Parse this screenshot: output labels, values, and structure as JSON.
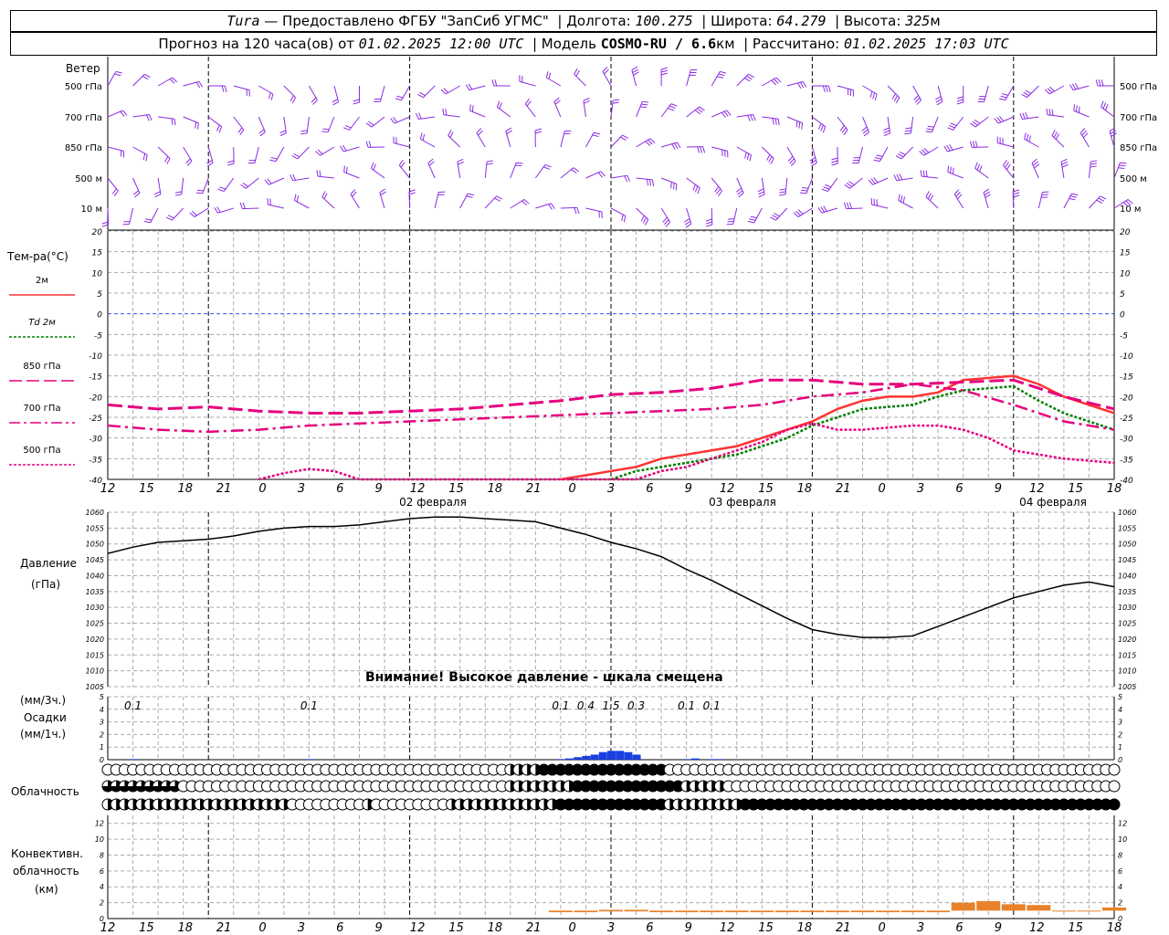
{
  "header": {
    "station": "Tura",
    "provider": "— Предоставлено ФГБУ \"ЗапСиб УГМС\"",
    "lon_label": "Долгота:",
    "lon_value": "100.275",
    "lat_label": "Широта:",
    "lat_value": "64.279",
    "alt_label": "Высота:",
    "alt_value": "325",
    "alt_unit": "м",
    "forecast_label": "Прогноз на 120 часа(ов) от",
    "forecast_time": "01.02.2025 12:00 UTC",
    "model_label": "Модель",
    "model_name": "COSMO-RU / 6.6",
    "model_unit": "км",
    "calc_label": "Рассчитано:",
    "calc_time": "01.02.2025 17:03 UTC"
  },
  "wind": {
    "title": "Ветер",
    "levels": [
      "500 гПа",
      "700 гПа",
      "850 гПа",
      "500 м",
      "10  м"
    ]
  },
  "temperature": {
    "title": "Тем-ра(°С)",
    "legend": [
      "2м",
      "Td  2м",
      "850 гПа",
      "700 гПа",
      "500 гПа"
    ],
    "ticks": [
      "20",
      "15",
      "10",
      "5",
      "0",
      "-5",
      "-10",
      "-15",
      "-20",
      "-25",
      "-30",
      "-35",
      "-40"
    ]
  },
  "time_axis": {
    "hours": [
      "12",
      "15",
      "18",
      "21",
      "0",
      "3",
      "6",
      "9",
      "12",
      "15",
      "18",
      "21",
      "0",
      "3",
      "6",
      "9",
      "12",
      "15",
      "18",
      "21",
      "0",
      "3",
      "6",
      "9",
      "12",
      "15",
      "18"
    ],
    "dates": [
      "02 февраля",
      "03 февраля",
      "04 февраля"
    ]
  },
  "pressure": {
    "title1": "Давление",
    "title2": "(гПа)",
    "warning": "Внимание! Высокое давление - шкала смещена",
    "ticks": [
      "1060",
      "1055",
      "1050",
      "1045",
      "1040",
      "1035",
      "1030",
      "1025",
      "1020",
      "1015",
      "1010",
      "1005"
    ]
  },
  "precip": {
    "title1": "(мм/3ч.)",
    "title2": "Осадки",
    "title3": "(мм/1ч.)",
    "ticks": [
      "5",
      "4",
      "3",
      "2",
      "1",
      "0"
    ],
    "labels": [
      {
        "hour": 3,
        "text": "0.1"
      },
      {
        "hour": 24,
        "text": "0.1"
      },
      {
        "hour": 54,
        "text": "0.1"
      },
      {
        "hour": 57,
        "text": "0.4"
      },
      {
        "hour": 60,
        "text": "1.5"
      },
      {
        "hour": 63,
        "text": "0.3"
      },
      {
        "hour": 69,
        "text": "0.1"
      },
      {
        "hour": 72,
        "text": "0.1"
      }
    ]
  },
  "cloud": {
    "title": "Облачность"
  },
  "convective": {
    "title1": "Конвективн.",
    "title2": "облачность",
    "title3": "(км)",
    "ticks": [
      "12",
      "10",
      "8",
      "6",
      "4",
      "2",
      "0"
    ]
  },
  "colors": {
    "t2m": "#ff3333",
    "td2m": "#008000",
    "t850": "#e6007e",
    "t700": "#e6007e",
    "t500": "#e6007e",
    "wind": "#8a2be2",
    "precip": "#1a3fe0",
    "convective": "#e8822a"
  },
  "chart_data": [
    {
      "type": "line",
      "title": "Тем-ра(°С)",
      "x_unit": "hours from 01.02.2025 12:00 UTC",
      "ylim": [
        -40,
        20
      ],
      "series": [
        {
          "name": "2м",
          "x": [
            54,
            57,
            60,
            63,
            66,
            69,
            72,
            75,
            78,
            81,
            84,
            87,
            90,
            93,
            96,
            99,
            102,
            105,
            108,
            111,
            114,
            117,
            120
          ],
          "values": [
            -40,
            -39,
            -38,
            -37,
            -35,
            -34,
            -33,
            -32,
            -30,
            -28,
            -26,
            -23,
            -21,
            -20,
            -20,
            -19,
            -16,
            -15.5,
            -15,
            -17,
            -20,
            -22,
            -24
          ]
        },
        {
          "name": "Td  2м",
          "x": [
            60,
            63,
            66,
            69,
            72,
            75,
            78,
            81,
            84,
            87,
            90,
            93,
            96,
            99,
            102,
            105,
            108,
            111,
            114,
            117,
            120
          ],
          "values": [
            -40,
            -38,
            -37,
            -36,
            -35,
            -34,
            -32,
            -30,
            -27,
            -25,
            -23,
            -22.5,
            -22,
            -20,
            -18.5,
            -18,
            -17.5,
            -21,
            -24,
            -26,
            -28
          ]
        },
        {
          "name": "850 гПа",
          "x": [
            0,
            6,
            12,
            18,
            24,
            30,
            36,
            42,
            48,
            54,
            60,
            66,
            72,
            78,
            84,
            90,
            96,
            102,
            108,
            114,
            120
          ],
          "values": [
            -22,
            -23,
            -22.5,
            -23.5,
            -24,
            -24,
            -23.5,
            -23,
            -22,
            -21,
            -19.5,
            -19,
            -18,
            -16,
            -16,
            -17,
            -17,
            -16.5,
            -16,
            -20,
            -23
          ]
        },
        {
          "name": "700 гПа",
          "x": [
            0,
            6,
            12,
            18,
            24,
            30,
            36,
            42,
            48,
            54,
            60,
            66,
            72,
            78,
            84,
            90,
            96,
            102,
            108,
            114,
            120
          ],
          "values": [
            -27,
            -28,
            -28.5,
            -28,
            -27,
            -26.5,
            -26,
            -25.5,
            -25,
            -24.5,
            -24,
            -23.5,
            -23,
            -22,
            -20,
            -19,
            -17,
            -18.5,
            -22,
            -26,
            -28
          ]
        },
        {
          "name": "500 гПа",
          "x": [
            18,
            21,
            24,
            27,
            30,
            33,
            36,
            39,
            42,
            45,
            48,
            51,
            54,
            57,
            60,
            63,
            66,
            69,
            72,
            75,
            78,
            81,
            84,
            87,
            90,
            93,
            96,
            99,
            102,
            105,
            108,
            111,
            114,
            117,
            120
          ],
          "values": [
            -40,
            -38.5,
            -37.5,
            -38,
            -40,
            -40,
            -40,
            -40,
            -40,
            -40,
            -40,
            -40,
            -40,
            -40,
            -40,
            -40,
            -38,
            -37,
            -35,
            -33,
            -31,
            -28,
            -26.5,
            -28,
            -28,
            -27.5,
            -27,
            -27,
            -28,
            -30,
            -33,
            -34,
            -35,
            -35.5,
            -36
          ]
        }
      ]
    },
    {
      "type": "line",
      "title": "Давление",
      "x_unit": "hours from 01.02.2025 12:00 UTC",
      "ylim": [
        1005,
        1060
      ],
      "series": [
        {
          "name": "Давление",
          "x": [
            0,
            3,
            6,
            9,
            12,
            15,
            18,
            21,
            24,
            27,
            30,
            33,
            36,
            39,
            42,
            45,
            48,
            51,
            54,
            57,
            60,
            63,
            66,
            69,
            72,
            75,
            78,
            81,
            84,
            87,
            90,
            93,
            96,
            99,
            102,
            105,
            108,
            111,
            114,
            117,
            120
          ],
          "values": [
            1047,
            1049,
            1050.5,
            1051,
            1051.5,
            1052.5,
            1054,
            1055,
            1055.5,
            1055.5,
            1056,
            1057,
            1058,
            1058.5,
            1058.5,
            1058,
            1057.5,
            1057,
            1055,
            1053,
            1050.5,
            1048.5,
            1046,
            1042,
            1038.5,
            1034.5,
            1030.5,
            1026.5,
            1023,
            1021.5,
            1020.5,
            1020.5,
            1021,
            1024,
            1027,
            1030,
            1033,
            1035,
            1037,
            1038,
            1036.5
          ]
        }
      ]
    },
    {
      "type": "bar",
      "title": "Осадки",
      "x_unit": "hours from 01.02.2025 12:00 UTC",
      "ylim": [
        0,
        5
      ],
      "series": [
        {
          "name": "мм/1ч",
          "x": [
            3,
            24,
            54,
            55,
            56,
            57,
            58,
            59,
            60,
            61,
            62,
            63,
            69,
            70,
            72,
            73
          ],
          "values": [
            0.05,
            0.05,
            0.05,
            0.1,
            0.2,
            0.3,
            0.4,
            0.6,
            0.7,
            0.7,
            0.6,
            0.4,
            0.05,
            0.1,
            0.05,
            0.05
          ]
        }
      ]
    },
    {
      "type": "bar",
      "title": "Конвективн. облачность",
      "x_unit": "hours from 01.02.2025 12:00 UTC",
      "ylim": [
        0,
        13
      ],
      "series": [
        {
          "name": "км",
          "x": [
            54,
            57,
            60,
            63,
            66,
            69,
            72,
            75,
            78,
            81,
            84,
            87,
            90,
            93,
            96,
            99,
            102,
            105,
            108,
            111,
            114,
            117,
            120
          ],
          "bottom": [
            0.8,
            0.8,
            0.9,
            0.9,
            0.8,
            0.8,
            0.8,
            0.8,
            0.8,
            0.8,
            0.8,
            0.8,
            0.8,
            0.8,
            0.8,
            0.8,
            1.0,
            1.0,
            1.0,
            1.0,
            1.0,
            1.0,
            1.0
          ],
          "top": [
            1.0,
            1.0,
            1.1,
            1.1,
            1.0,
            1.0,
            1.0,
            1.0,
            1.0,
            1.0,
            1.0,
            1.0,
            1.0,
            1.0,
            1.0,
            1.0,
            2.0,
            2.2,
            1.8,
            1.7,
            1.0,
            1.0,
            1.4
          ]
        }
      ]
    }
  ]
}
